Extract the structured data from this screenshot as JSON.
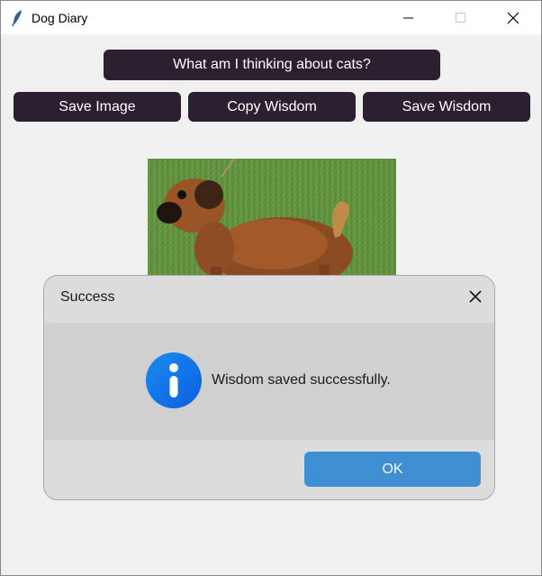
{
  "window": {
    "title": "Dog Diary",
    "icon": "feather-icon"
  },
  "buttons": {
    "think": "What am I thinking about cats?",
    "save_image": "Save Image",
    "copy_wisdom": "Copy Wisdom",
    "save_wisdom": "Save Wisdom"
  },
  "image": {
    "subject": "dog-photo"
  },
  "dialog": {
    "title": "Success",
    "message": "Wisdom saved successfully.",
    "ok_label": "OK",
    "icon": "info-icon"
  },
  "colors": {
    "button_bg": "#2c1f2f",
    "button_text": "#ffffff",
    "ok_bg": "#3f8fd2",
    "info_blue": "#1a7cf0"
  }
}
